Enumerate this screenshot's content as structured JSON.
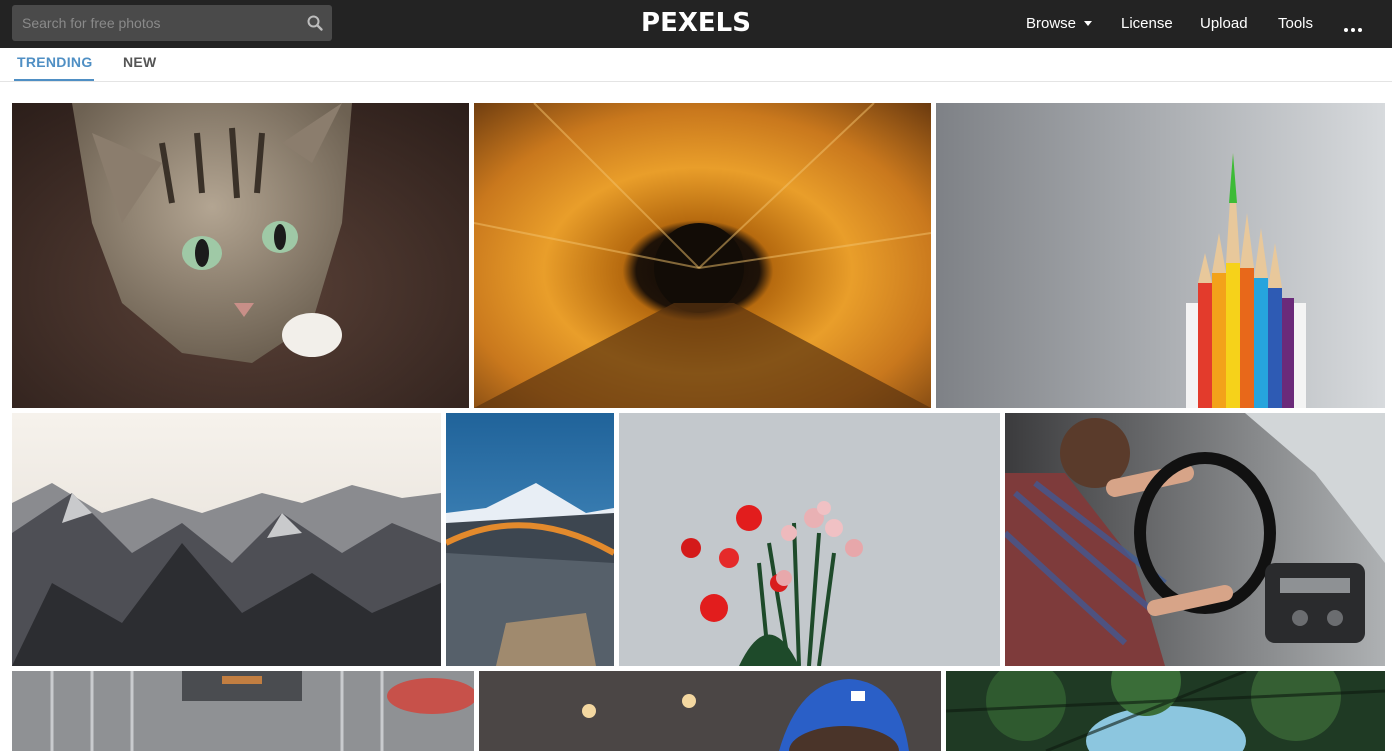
{
  "header": {
    "search_placeholder": "Search for free photos",
    "logo": "PEXELS",
    "nav": {
      "browse": "Browse",
      "license": "License",
      "upload": "Upload",
      "tools": "Tools"
    }
  },
  "tabs": {
    "trending": "TRENDING",
    "new": "NEW",
    "active": "trending"
  },
  "colors": {
    "topbar": "#232323",
    "accent": "#4f8fc4"
  },
  "icons": [
    "search-icon",
    "caret-down-icon",
    "more-options-icon"
  ]
}
